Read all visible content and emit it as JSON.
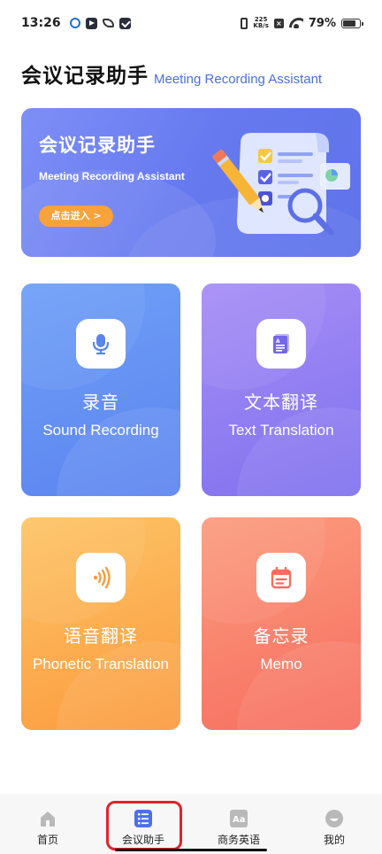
{
  "status_bar": {
    "time": "13:26",
    "network_speed_value": "225",
    "network_speed_unit": "KB/s",
    "battery": "79%",
    "battery_level": 0.79
  },
  "header": {
    "title": "会议记录助手",
    "subtitle": "Meeting Recording Assistant"
  },
  "banner": {
    "title": "会议记录助手",
    "subtitle": "Meeting Recording Assistant",
    "button_label": "点击进入 >"
  },
  "cards": {
    "record": {
      "title": "录音",
      "subtitle": "Sound Recording",
      "icon": "microphone-icon"
    },
    "text": {
      "title": "文本翻译",
      "subtitle": "Text Translation",
      "icon": "document-icon"
    },
    "phonetic": {
      "title": "语音翻译",
      "subtitle": "Phonetic Translation",
      "icon": "sound-wave-icon"
    },
    "memo": {
      "title": "备忘录",
      "subtitle": "Memo",
      "icon": "calendar-icon"
    }
  },
  "bottom_nav": {
    "items": [
      {
        "label": "首页",
        "icon": "home-icon"
      },
      {
        "label": "会议助手",
        "icon": "list-icon",
        "active": true
      },
      {
        "label": "商务英语",
        "icon": "aa-icon"
      },
      {
        "label": "我的",
        "icon": "profile-icon"
      }
    ]
  },
  "colors": {
    "accent": "#4a6fd8",
    "banner": "#6679ef",
    "record": "#5c84ef",
    "text": "#8a78f0",
    "phonetic": "#fba544",
    "memo": "#f7785f",
    "highlight": "#e2222b"
  }
}
